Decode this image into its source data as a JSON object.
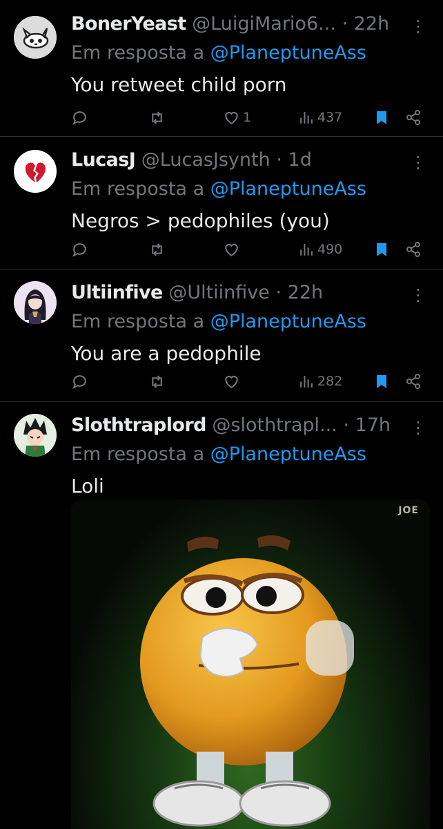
{
  "replies": [
    {
      "display_name": "BonerYeast",
      "handle": "@LuigiMario6...",
      "time": "22h",
      "reply_prefix": "Em resposta a",
      "reply_to": "@PlaneptuneAss",
      "text": "You retweet child porn",
      "likes": "1",
      "views": "437",
      "avatar_icon": "cat-skull-icon"
    },
    {
      "display_name": "LucasJ",
      "handle": "@LucasJsynth",
      "time": "1d",
      "reply_prefix": "Em resposta a",
      "reply_to": "@PlaneptuneAss",
      "text": "Negros > pedophiles (you)",
      "likes": "",
      "views": "490",
      "avatar_icon": "broken-heart-icon"
    },
    {
      "display_name": "Ultiinfive",
      "handle": "@Ultiinfive",
      "time": "22h",
      "reply_prefix": "Em resposta a",
      "reply_to": "@PlaneptuneAss",
      "text": "You are a pedophile",
      "likes": "",
      "views": "282",
      "avatar_icon": "anime-girl-avatar"
    },
    {
      "display_name": "Slothtraplord",
      "handle": "@slothtrapl...",
      "time": "17h",
      "reply_prefix": "Em resposta a",
      "reply_to": "@PlaneptuneAss",
      "text": "Loli",
      "avatar_icon": "anime-boy-avatar",
      "media": {
        "watermark": "JOE",
        "subject": "emoji-face-covering-mouth"
      }
    }
  ],
  "colors": {
    "background": "#000000",
    "text": "#e7e9ea",
    "muted": "#71767b",
    "link": "#1d9bf0",
    "divider": "#2f3336"
  }
}
